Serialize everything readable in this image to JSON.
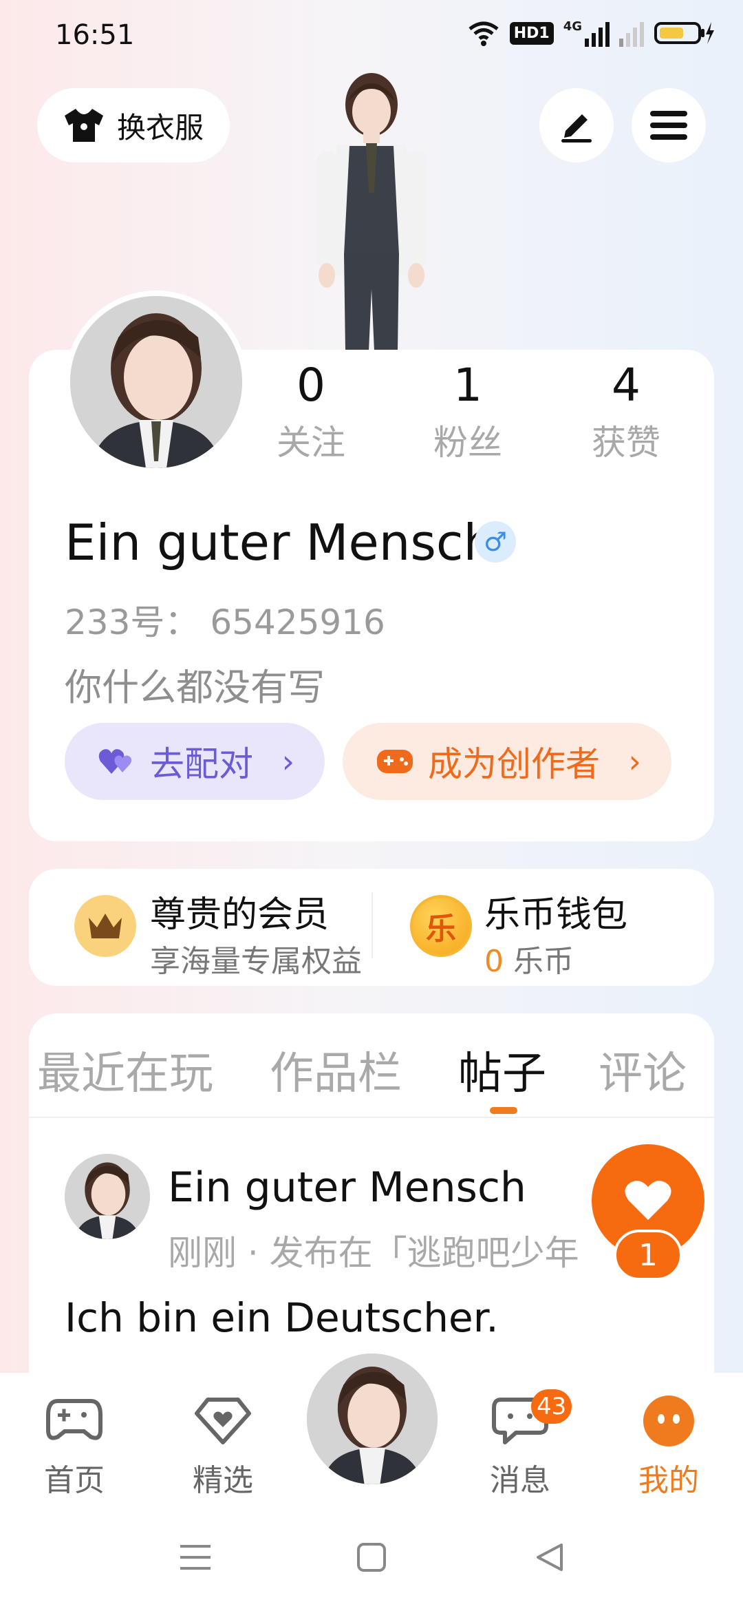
{
  "status_bar": {
    "time": "16:51",
    "hd_label": "HD1",
    "network_label": "4G"
  },
  "top_bar": {
    "dress_label": "换衣服"
  },
  "profile": {
    "stats": [
      {
        "value": "0",
        "label": "关注"
      },
      {
        "value": "1",
        "label": "粉丝"
      },
      {
        "value": "4",
        "label": "获赞"
      }
    ],
    "username": "Ein guter Mensch",
    "gender_symbol": "♂",
    "id_line": "233号： 65425916",
    "bio": "你什么都没有写",
    "match_button": "去配对",
    "creator_button": "成为创作者",
    "arrow": "›"
  },
  "membership": {
    "vip_title": "尊贵的会员",
    "vip_sub": "享海量专属权益",
    "wallet_title": "乐币钱包",
    "coin_glyph": "乐",
    "wallet_amount": "0",
    "wallet_unit": "乐币"
  },
  "tabs": [
    {
      "label": "最近在玩",
      "active": false
    },
    {
      "label": "作品栏",
      "active": false
    },
    {
      "label": "帖子",
      "active": true
    },
    {
      "label": "评论",
      "active": false
    }
  ],
  "post": {
    "author": "Ein guter Mensch",
    "meta": "刚刚 · 发布在「逃跑吧少年",
    "text": "Ich bin ein Deutscher.",
    "like_count": "1"
  },
  "bottom_nav": [
    {
      "label": "首页",
      "icon": "gamepad-icon",
      "active": false
    },
    {
      "label": "精选",
      "icon": "heart-diamond-icon",
      "active": false
    },
    {
      "label": "",
      "icon": "avatar-center",
      "active": false
    },
    {
      "label": "消息",
      "icon": "chat-icon",
      "active": false,
      "badge": "43"
    },
    {
      "label": "我的",
      "icon": "profile-face-icon",
      "active": true
    }
  ],
  "colors": {
    "accent_orange": "#f66a10",
    "match_purple": "#6b5bd6",
    "creator_orange": "#f06a1b"
  }
}
